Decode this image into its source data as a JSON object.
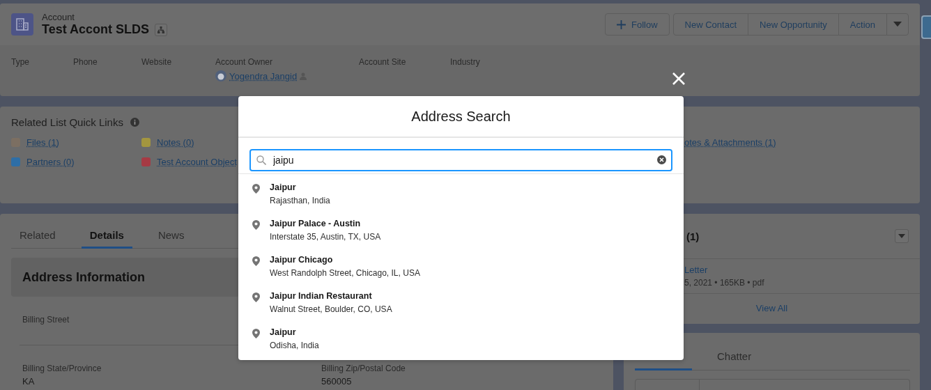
{
  "header": {
    "object_label": "Account",
    "title": "Test Accont SLDS",
    "actions": [
      {
        "kind": "follow",
        "label": "Follow"
      },
      {
        "kind": "group",
        "label": "New Contact"
      },
      {
        "kind": "group",
        "label": "New Opportunity"
      },
      {
        "kind": "group",
        "label": "Action"
      }
    ],
    "fields": [
      {
        "label": "Type"
      },
      {
        "label": "Phone"
      },
      {
        "label": "Website"
      },
      {
        "label": "Account Owner",
        "value": "Yogendra Jangid"
      },
      {
        "label": "Account Site"
      },
      {
        "label": "Industry"
      }
    ]
  },
  "quick_links": {
    "title": "Related List Quick Links",
    "rows": [
      [
        {
          "label": "Files (1)",
          "color": "#7c6f62"
        },
        {
          "label": "Notes (0)",
          "color": "#a3963f"
        },
        {
          "label": "otes & Attachments (1)"
        }
      ],
      [
        {
          "label": "Partners (0)",
          "color": "#2e6ea6"
        },
        {
          "label": "Test Account Object",
          "color": "#a63a44"
        }
      ]
    ]
  },
  "detail_tabs": [
    {
      "label": "Related",
      "selected": false
    },
    {
      "label": "Details",
      "selected": true
    },
    {
      "label": "News",
      "selected": false
    }
  ],
  "section": {
    "title": "Address Information",
    "fields": [
      {
        "label": "Billing Street"
      },
      {
        "label": "Billing State/Province",
        "value": "KA"
      },
      {
        "label": "Billing Zip/Postal Code",
        "value": "560005"
      }
    ]
  },
  "files_card": {
    "title": "(1)",
    "file_name": "Letter",
    "file_meta": "5, 2021 • 165KB • pdf",
    "view_all": "View All"
  },
  "feed_tabs": [
    {
      "label": "Chatter",
      "selected": false
    }
  ],
  "modal": {
    "title": "Address Search",
    "search": {
      "value": "jaipu"
    },
    "results": [
      {
        "name": "Jaipur",
        "address": "Rajasthan, India"
      },
      {
        "name": "Jaipur Palace - Austin",
        "address": "Interstate 35, Austin, TX, USA"
      },
      {
        "name": "Jaipur Chicago",
        "address": "West Randolph Street, Chicago, IL, USA"
      },
      {
        "name": "Jaipur Indian Restaurant",
        "address": "Walnut Street, Boulder, CO, USA"
      },
      {
        "name": "Jaipur",
        "address": "Odisha, India"
      }
    ]
  }
}
